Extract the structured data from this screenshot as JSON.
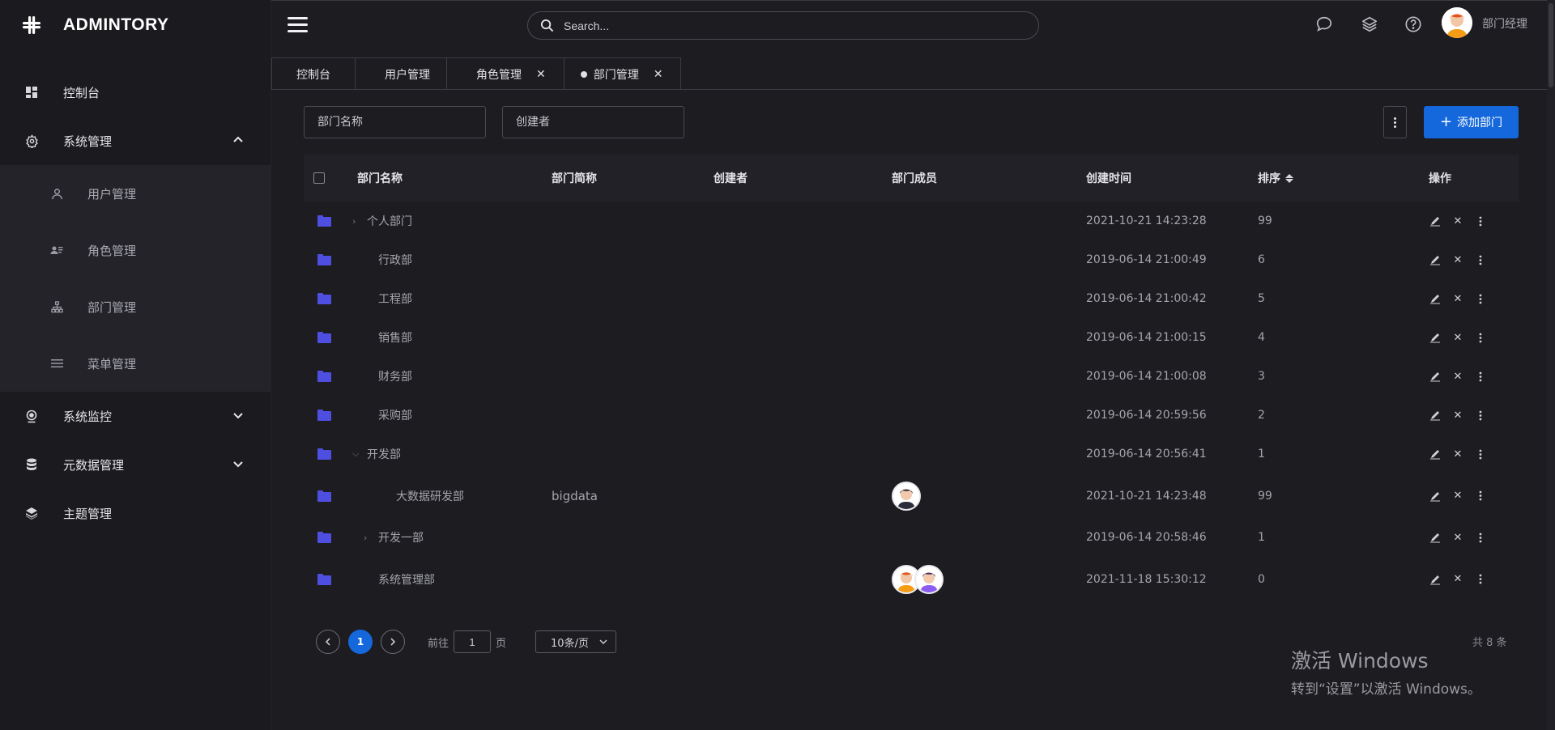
{
  "app": {
    "brand": "ADMINTORY"
  },
  "sidebar": {
    "items": [
      {
        "label": "控制台",
        "icon": "dashboard-icon"
      },
      {
        "label": "系统管理",
        "icon": "gear-icon",
        "expanded": true
      },
      {
        "label": "系统监控",
        "icon": "webcam-icon",
        "expanded": false
      },
      {
        "label": "元数据管理",
        "icon": "database-icon",
        "expanded": false
      },
      {
        "label": "主题管理",
        "icon": "layers-icon"
      }
    ],
    "sub_items": [
      {
        "label": "用户管理",
        "icon": "user-icon"
      },
      {
        "label": "角色管理",
        "icon": "id-card-icon"
      },
      {
        "label": "部门管理",
        "icon": "org-chart-icon"
      },
      {
        "label": "菜单管理",
        "icon": "list-icon"
      }
    ]
  },
  "header": {
    "search_placeholder": "Search...",
    "user_name": "部门经理",
    "icons": [
      "chat-icon",
      "layers-icon",
      "help-icon"
    ]
  },
  "tabs": [
    {
      "label": "控制台",
      "closable": false,
      "active": false
    },
    {
      "label": "用户管理",
      "closable": false,
      "active": false
    },
    {
      "label": "角色管理",
      "closable": true,
      "active": false
    },
    {
      "label": "部门管理",
      "closable": true,
      "active": true
    }
  ],
  "filters": {
    "dept_name_placeholder": "部门名称",
    "creator_placeholder": "创建者",
    "add_label": "添加部门"
  },
  "table": {
    "columns": {
      "name": "部门名称",
      "short": "部门简称",
      "creator": "创建者",
      "members": "部门成员",
      "created": "创建时间",
      "order": "排序",
      "actions": "操作"
    },
    "rows": [
      {
        "name": "个人部门",
        "short": "",
        "created": "2021-10-21 14:23:28",
        "order": "99"
      },
      {
        "name": "行政部",
        "short": "",
        "created": "2019-06-14 21:00:49",
        "order": "6"
      },
      {
        "name": "工程部",
        "short": "",
        "created": "2019-06-14 21:00:42",
        "order": "5"
      },
      {
        "name": "销售部",
        "short": "",
        "created": "2019-06-14 21:00:15",
        "order": "4"
      },
      {
        "name": "财务部",
        "short": "",
        "created": "2019-06-14 21:00:08",
        "order": "3"
      },
      {
        "name": "采购部",
        "short": "",
        "created": "2019-06-14 20:59:56",
        "order": "2"
      },
      {
        "name": "开发部",
        "short": "",
        "created": "2019-06-14 20:56:41",
        "order": "1"
      },
      {
        "name": "大数据研发部",
        "short": "bigdata",
        "created": "2021-10-21 14:23:48",
        "order": "99"
      },
      {
        "name": "开发一部",
        "short": "",
        "created": "2019-06-14 20:58:46",
        "order": "1"
      },
      {
        "name": "系统管理部",
        "short": "",
        "created": "2021-11-18 15:30:12",
        "order": "0"
      }
    ]
  },
  "pagination": {
    "current": "1",
    "goto_prefix": "前往",
    "goto_value": "1",
    "goto_suffix": "页",
    "page_size": "10条/页",
    "total": "共 8 条"
  },
  "watermark": {
    "line1": "激活 Windows",
    "line2": "转到“设置”以激活 Windows。"
  },
  "colors": {
    "accent": "#1468dc",
    "folder": "#4e4fe0",
    "background": "#1c1c21",
    "sidebar": "#1a1a1f"
  }
}
